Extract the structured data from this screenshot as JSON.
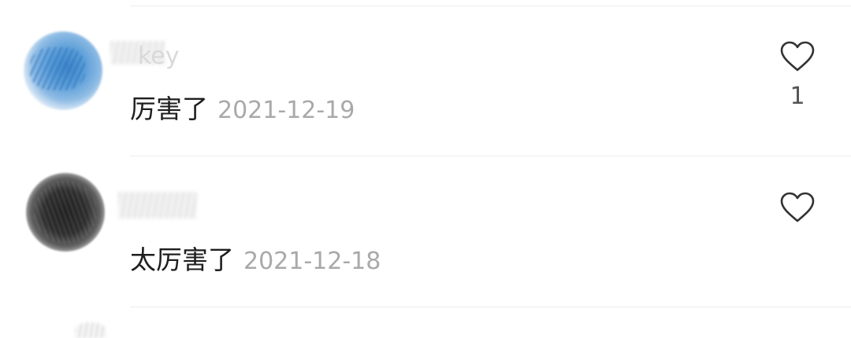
{
  "comments": [
    {
      "username_visible": "key",
      "text": "厉害了",
      "date": "2021-12-19",
      "like_count": "1",
      "icons": {
        "like": "heart-outline-icon",
        "avatar": "blue-avatar-image"
      }
    },
    {
      "username_visible": "",
      "text": "太厉害了",
      "date": "2021-12-18",
      "like_count": "",
      "icons": {
        "like": "heart-outline-icon",
        "avatar": "dark-avatar-image"
      }
    }
  ],
  "colors": {
    "text": "#1e1e1e",
    "date": "#a9a9a9",
    "divider": "#ececec",
    "icon": "#333333"
  }
}
